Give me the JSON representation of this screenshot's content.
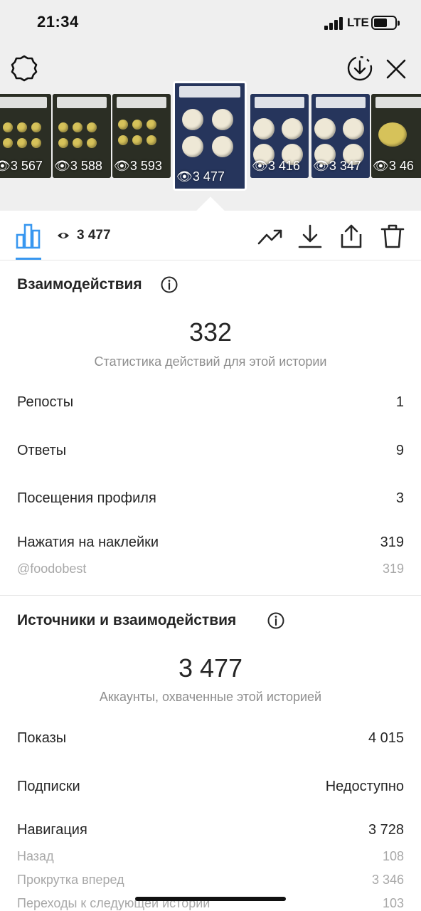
{
  "status_bar": {
    "time": "21:34",
    "network": "LTE"
  },
  "thumbnails": [
    {
      "views": "3 567",
      "style": "tray"
    },
    {
      "views": "3 588",
      "style": "tray"
    },
    {
      "views": "3 593",
      "style": "tray"
    },
    {
      "views": "3 477",
      "style": "navy",
      "active": true
    },
    {
      "views": "3 416",
      "style": "navy"
    },
    {
      "views": "3 347",
      "style": "navy"
    },
    {
      "views": "3 46",
      "style": "tray"
    }
  ],
  "tabs": {
    "views": "3 477"
  },
  "interactions": {
    "title": "Взаимодействия",
    "total": "332",
    "subtitle": "Статистика действий для этой истории",
    "rows": [
      {
        "label": "Репосты",
        "value": "1"
      },
      {
        "label": "Ответы",
        "value": "9"
      },
      {
        "label": "Посещения профиля",
        "value": "3"
      },
      {
        "label": "Нажатия на наклейки",
        "value": "319"
      }
    ],
    "sticker": {
      "label": "@foodobest",
      "value": "319"
    }
  },
  "discovery": {
    "title": "Источники и взаимодействия",
    "total": "3 477",
    "subtitle": "Аккаунты, охваченные этой историей",
    "rows": [
      {
        "label": "Показы",
        "value": "4 015"
      },
      {
        "label": "Подписки",
        "value": "Недоступно"
      },
      {
        "label": "Навигация",
        "value": "3 728"
      }
    ],
    "navigation": [
      {
        "label": "Назад",
        "value": "108"
      },
      {
        "label": "Прокрутка вперед",
        "value": "3 346"
      },
      {
        "label": "Переходы к следующей истории",
        "value": "103"
      }
    ]
  },
  "colors": {
    "accent": "#3897f0",
    "text": "#262626",
    "muted": "#8e8e8e",
    "top_bg": "#efefef"
  }
}
